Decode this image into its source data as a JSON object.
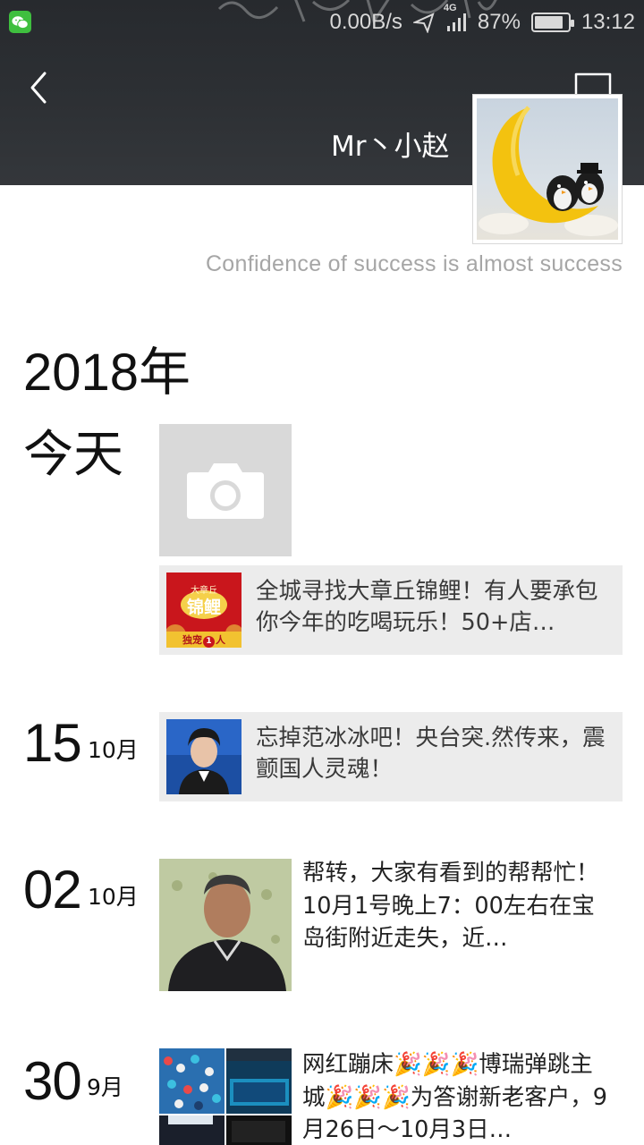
{
  "status_bar": {
    "net_speed": "0.00B/s",
    "network": "4G",
    "battery": "87%",
    "battery_level": 0.87,
    "time": "13:12"
  },
  "header": {
    "name": "Mr丶小赵",
    "signature": "Confidence of success is almost success"
  },
  "timeline": {
    "year": "2018年",
    "today_label": "今天",
    "today_share_title": "全城寻找大章丘锦鲤！有人要承包你今年的吃喝玩乐！50+店…",
    "today_share_thumb_text_top": "大章丘",
    "today_share_thumb_text_main": "锦鲤",
    "today_share_thumb_text_bottom": "独宠",
    "today_share_thumb_text_num": "1",
    "today_share_thumb_text_person": "人",
    "entries": [
      {
        "day": "15",
        "month": "10月",
        "text": "忘掉范冰冰吧！央台突.然传来，震颤国人灵魂！"
      },
      {
        "day": "02",
        "month": "10月",
        "text": "帮转，大家有看到的帮帮忙！10月1号晚上7：00左右在宝岛街附近走失，近…"
      },
      {
        "day": "30",
        "month": "9月",
        "text": "网红蹦床🎉🎉🎉博瑞弹跳主城🎉🎉🎉为答谢新老客户，9月26日～10月3日…"
      }
    ]
  },
  "colors": {
    "header_bg": "#2d3034",
    "card_bg": "#ececec",
    "camera_tile_bg": "#d9d9d9",
    "wechat_green": "#3fbf3f"
  },
  "icons": {
    "status_app": "wechat-icon",
    "back": "chevron-left-icon",
    "message": "speech-bubble-icon",
    "camera": "camera-icon"
  }
}
